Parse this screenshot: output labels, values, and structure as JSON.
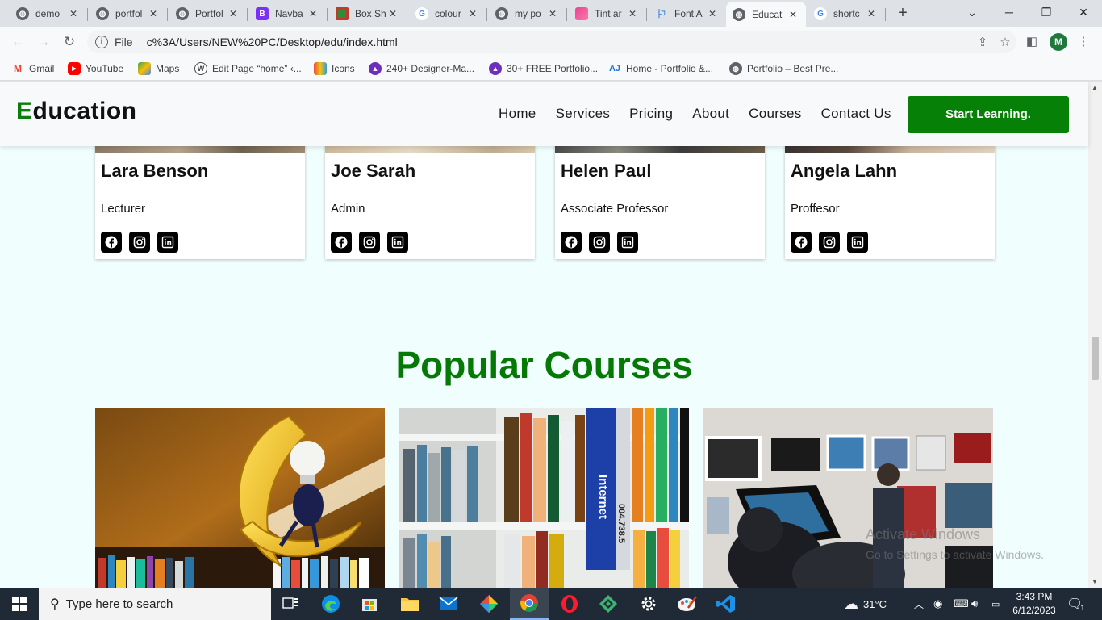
{
  "browser": {
    "tabs": [
      {
        "title": "demo",
        "favicon": "globe-icon"
      },
      {
        "title": "portfol",
        "favicon": "globe-icon"
      },
      {
        "title": "Portfol",
        "favicon": "globe-icon"
      },
      {
        "title": "Navba",
        "favicon": "bootstrap-icon"
      },
      {
        "title": "Box Sh",
        "favicon": "box-icon"
      },
      {
        "title": "colour",
        "favicon": "google-icon"
      },
      {
        "title": "my po",
        "favicon": "globe-icon"
      },
      {
        "title": "Tint ar",
        "favicon": "tint-icon"
      },
      {
        "title": "Font A",
        "favicon": "flag-icon"
      },
      {
        "title": "Educat",
        "favicon": "globe-icon",
        "active": true
      },
      {
        "title": "shortc",
        "favicon": "google-icon"
      }
    ],
    "new_tab": "+",
    "address": {
      "scheme_label": "File",
      "url": "c%3A/Users/NEW%20PC/Desktop/edu/index.html"
    },
    "profile_initial": "M",
    "bookmarks": [
      {
        "label": "Gmail",
        "icon": "gmail-icon"
      },
      {
        "label": "YouTube",
        "icon": "youtube-icon"
      },
      {
        "label": "Maps",
        "icon": "maps-icon"
      },
      {
        "label": "Edit Page “home” ‹...",
        "icon": "wordpress-icon"
      },
      {
        "label": "Icons",
        "icon": "icons-icon"
      },
      {
        "label": "240+ Designer-Ma...",
        "icon": "arc-icon"
      },
      {
        "label": "30+ FREE Portfolio...",
        "icon": "arc-icon"
      },
      {
        "label": "Home - Portfolio &...",
        "icon": "aj-icon"
      },
      {
        "label": "Portfolio – Best Pre...",
        "icon": "globe-icon"
      }
    ]
  },
  "site": {
    "logo_first": "E",
    "logo_rest": "ducation",
    "nav": [
      "Home",
      "Services",
      "Pricing",
      "About",
      "Courses",
      "Contact Us"
    ],
    "cta": "Start Learning.",
    "team": [
      {
        "name": "Lara Benson",
        "role": "Lecturer"
      },
      {
        "name": "Joe Sarah",
        "role": "Admin"
      },
      {
        "name": "Helen Paul",
        "role": "Associate Professor"
      },
      {
        "name": "Angela Lahn",
        "role": "Proffesor"
      }
    ],
    "social_icons": [
      "facebook-icon",
      "instagram-icon",
      "linkedin-icon"
    ],
    "section_title": "Popular Courses",
    "course_images": [
      {
        "label": "moon-lamp-photo",
        "book_text": ""
      },
      {
        "label": "bookshelf-photo",
        "book_text": "Internet",
        "book_code": "004.738.5"
      },
      {
        "label": "gallery-presentation-photo",
        "book_text": ""
      }
    ]
  },
  "watermark": {
    "line1": "Activate Windows",
    "line2": "Go to Settings to activate Windows."
  },
  "taskbar": {
    "search_placeholder": "Type here to search",
    "weather": "31°C",
    "time": "3:43 PM",
    "date": "6/12/2023",
    "notification_count": "1",
    "apps": [
      "task-view-icon",
      "edge-icon",
      "store-icon",
      "file-explorer-icon",
      "mail-icon",
      "colorful-app-icon",
      "chrome-icon",
      "opera-icon",
      "kite-icon",
      "settings-icon",
      "paint-icon",
      "vscode-icon"
    ]
  },
  "colors": {
    "brand_green": "#078007",
    "page_bg": "#f0fffe",
    "taskbar_bg": "#1f2a36"
  }
}
